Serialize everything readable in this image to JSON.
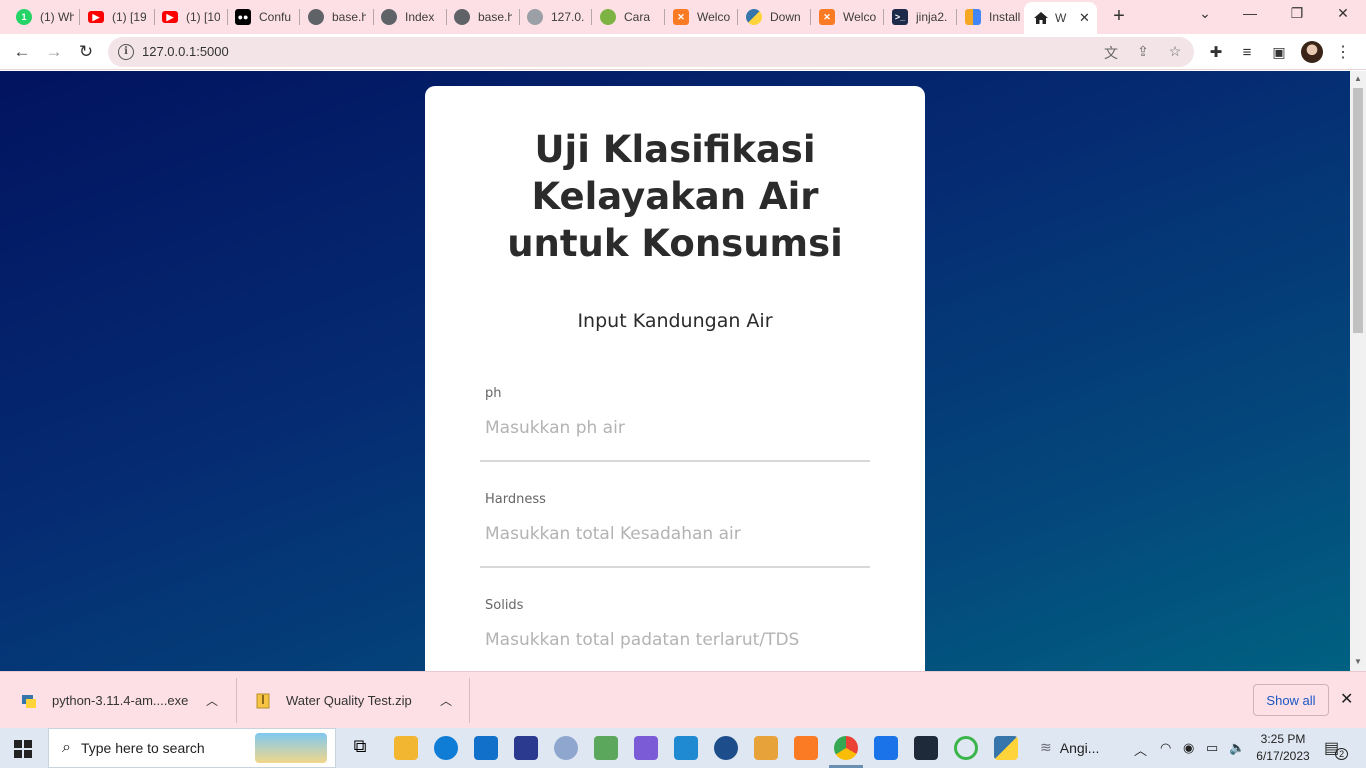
{
  "browser": {
    "tabs": [
      {
        "label": "(1) Wh",
        "icon": "whatsapp-icon",
        "color": "#25d366"
      },
      {
        "label": "(1) [19",
        "icon": "youtube-icon",
        "color": "#ff0000"
      },
      {
        "label": "(1) [10",
        "icon": "youtube-icon",
        "color": "#ff0000"
      },
      {
        "label": "Confu",
        "icon": "medium-icon",
        "color": "#000000"
      },
      {
        "label": "base.h",
        "icon": "globe-icon",
        "color": "#5f6368"
      },
      {
        "label": "Index",
        "icon": "globe-icon",
        "color": "#5f6368"
      },
      {
        "label": "base.h",
        "icon": "globe-icon",
        "color": "#5f6368"
      },
      {
        "label": "127.0.",
        "icon": "globe-icon",
        "color": "#9aa0a6"
      },
      {
        "label": "Cara",
        "icon": "android-icon",
        "color": "#7cb342"
      },
      {
        "label": "Welco",
        "icon": "xampp-icon",
        "color": "#fb7a24"
      },
      {
        "label": "Down",
        "icon": "python-icon",
        "color": "#3776ab"
      },
      {
        "label": "Welco",
        "icon": "xampp-icon",
        "color": "#fb7a24"
      },
      {
        "label": "jinja2.",
        "icon": "terminal-icon",
        "color": "#1e2a4a"
      },
      {
        "label": "Install",
        "icon": "tool-icon",
        "color": "#f5a623"
      }
    ],
    "active_tab": {
      "label": "W",
      "icon": "home-icon"
    },
    "url": "127.0.0.1:5000"
  },
  "page": {
    "title": "Uji Klasifikasi Kelayakan Air untuk Konsumsi",
    "subtitle": "Input Kandungan Air",
    "fields": [
      {
        "label": "ph",
        "placeholder": "Masukkan ph air"
      },
      {
        "label": "Hardness",
        "placeholder": "Masukkan total Kesadahan air"
      },
      {
        "label": "Solids",
        "placeholder": "Masukkan total padatan terlarut/TDS"
      }
    ]
  },
  "downloads": {
    "items": [
      {
        "name": "python-3.11.4-am....exe"
      },
      {
        "name": "Water Quality Test.zip"
      }
    ],
    "show_all": "Show all"
  },
  "taskbar": {
    "search_placeholder": "Type here to search",
    "weather": "Angi...",
    "time": "3:25 PM",
    "date": "6/17/2023",
    "notifications": "2"
  }
}
